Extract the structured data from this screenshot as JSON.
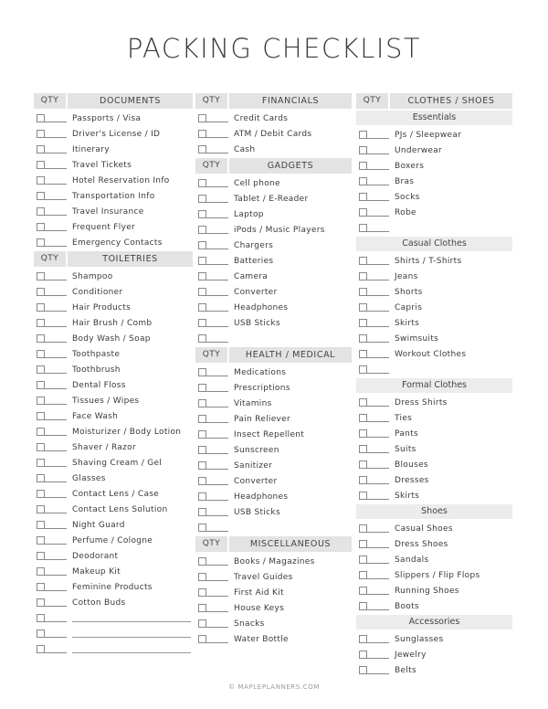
{
  "title": "PACKING CHECKLIST",
  "qty_label": "QTY",
  "footer": "© MAPLEPLANNERS.COM",
  "columns": [
    {
      "sections": [
        {
          "title": "DOCUMENTS",
          "items": [
            "Passports / Visa",
            "Driver's License / ID",
            "Itinerary",
            "Travel Tickets",
            "Hotel Reservation Info",
            "Transportation Info",
            "Travel Insurance",
            "Frequent Flyer",
            "Emergency Contacts"
          ],
          "blank_rows": 0,
          "blank_lines": 0
        },
        {
          "title": "TOILETRIES",
          "items": [
            "Shampoo",
            "Conditioner",
            "Hair Products",
            "Hair Brush / Comb",
            "Body Wash / Soap",
            "Toothpaste",
            "Toothbrush",
            "Dental Floss",
            "Tissues / Wipes",
            "Face Wash",
            "Moisturizer / Body Lotion",
            "Shaver / Razor",
            "Shaving Cream / Gel",
            "Glasses",
            "Contact Lens / Case",
            "Contact Lens Solution",
            "Night Guard",
            "Perfume / Cologne",
            "Deodorant",
            "Makeup Kit",
            "Feminine Products",
            "Cotton Buds"
          ],
          "blank_rows": 0,
          "blank_lines": 3
        }
      ]
    },
    {
      "sections": [
        {
          "title": "FINANCIALS",
          "items": [
            "Credit Cards",
            "ATM / Debit Cards",
            "Cash"
          ],
          "blank_rows": 0,
          "blank_lines": 0
        },
        {
          "title": "GADGETS",
          "items": [
            "Cell phone",
            "Tablet / E-Reader",
            "Laptop",
            "iPods / Music Players",
            "Chargers",
            "Batteries",
            "Camera",
            "Converter",
            "Headphones",
            "USB Sticks"
          ],
          "blank_rows": 1,
          "blank_lines": 0
        },
        {
          "title": "HEALTH / MEDICAL",
          "items": [
            "Medications",
            "Prescriptions",
            "Vitamins",
            "Pain Reliever",
            "Insect Repellent",
            "Sunscreen",
            "Sanitizer",
            "Converter",
            "Headphones",
            "USB Sticks"
          ],
          "blank_rows": 1,
          "blank_lines": 0
        },
        {
          "title": "MISCELLANEOUS",
          "items": [
            "Books / Magazines",
            "Travel Guides",
            "First Aid Kit",
            "House Keys",
            "Snacks",
            "Water Bottle"
          ],
          "blank_rows": 0,
          "blank_lines": 0
        }
      ]
    },
    {
      "title": "CLOTHES / SHOES",
      "subsections": [
        {
          "title": "Essentials",
          "items": [
            "PJs / Sleepwear",
            "Underwear",
            "Boxers",
            "Bras",
            "Socks",
            "Robe"
          ],
          "blank_rows": 1
        },
        {
          "title": "Casual Clothes",
          "items": [
            "Shirts / T-Shirts",
            "Jeans",
            "Shorts",
            "Capris",
            "Skirts",
            "Swimsuits",
            "Workout Clothes"
          ],
          "blank_rows": 1
        },
        {
          "title": "Formal Clothes",
          "items": [
            "Dress Shirts",
            "Ties",
            "Pants",
            "Suits",
            "Blouses",
            "Dresses",
            "Skirts"
          ],
          "blank_rows": 0
        },
        {
          "title": "Shoes",
          "items": [
            "Casual Shoes",
            "Dress Shoes",
            "Sandals",
            "Slippers / Flip Flops",
            "Running Shoes",
            "Boots"
          ],
          "blank_rows": 0
        },
        {
          "title": "Accessories",
          "items": [
            "Sunglasses",
            "Jewelry",
            "Belts"
          ],
          "blank_rows": 0
        }
      ]
    }
  ]
}
